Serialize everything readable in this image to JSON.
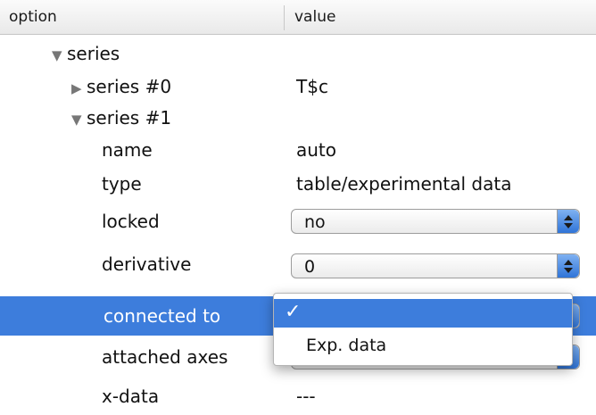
{
  "header": {
    "col_option": "option",
    "col_value": "value"
  },
  "rows": {
    "series": {
      "label": "series",
      "tri": "▼"
    },
    "series0": {
      "label": "series #0",
      "tri": "▶",
      "value": "T$c"
    },
    "series1": {
      "label": "series #1",
      "tri": "▼"
    },
    "name": {
      "label": "name",
      "value": "auto"
    },
    "type": {
      "label": "type",
      "value": "table/experimental data"
    },
    "locked": {
      "label": "locked",
      "value": "no"
    },
    "derivative": {
      "label": "derivative",
      "value": "0"
    },
    "connected_to": {
      "label": "connected to"
    },
    "attached_axes": {
      "label": "attached axes"
    },
    "x_data": {
      "label": "x-data",
      "value": "---"
    }
  },
  "dropdown_menu": {
    "items": [
      {
        "label": "",
        "checked": true,
        "check_glyph": "✓"
      },
      {
        "label": "Exp. data",
        "checked": false
      }
    ]
  },
  "colors": {
    "selection": "#3d7ddc",
    "stepper_blue": "#2f74d8"
  }
}
